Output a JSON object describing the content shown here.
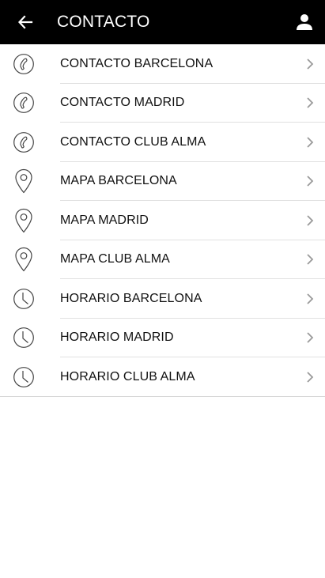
{
  "header": {
    "title": "CONTACTO",
    "back_icon": "arrow-left-icon",
    "account_icon": "person-icon",
    "background": "#000000",
    "text_color": "#ffffff"
  },
  "list": {
    "items": [
      {
        "label": "CONTACTO BARCELONA",
        "icon": "phone-icon"
      },
      {
        "label": "CONTACTO MADRID",
        "icon": "phone-icon"
      },
      {
        "label": "CONTACTO CLUB ALMA",
        "icon": "phone-icon"
      },
      {
        "label": "MAPA BARCELONA",
        "icon": "map-pin-icon"
      },
      {
        "label": "MAPA MADRID",
        "icon": "map-pin-icon"
      },
      {
        "label": "MAPA CLUB ALMA",
        "icon": "map-pin-icon"
      },
      {
        "label": "HORARIO BARCELONA",
        "icon": "clock-icon"
      },
      {
        "label": "HORARIO MADRID",
        "icon": "clock-icon"
      },
      {
        "label": "HORARIO CLUB ALMA",
        "icon": "clock-icon"
      }
    ]
  }
}
